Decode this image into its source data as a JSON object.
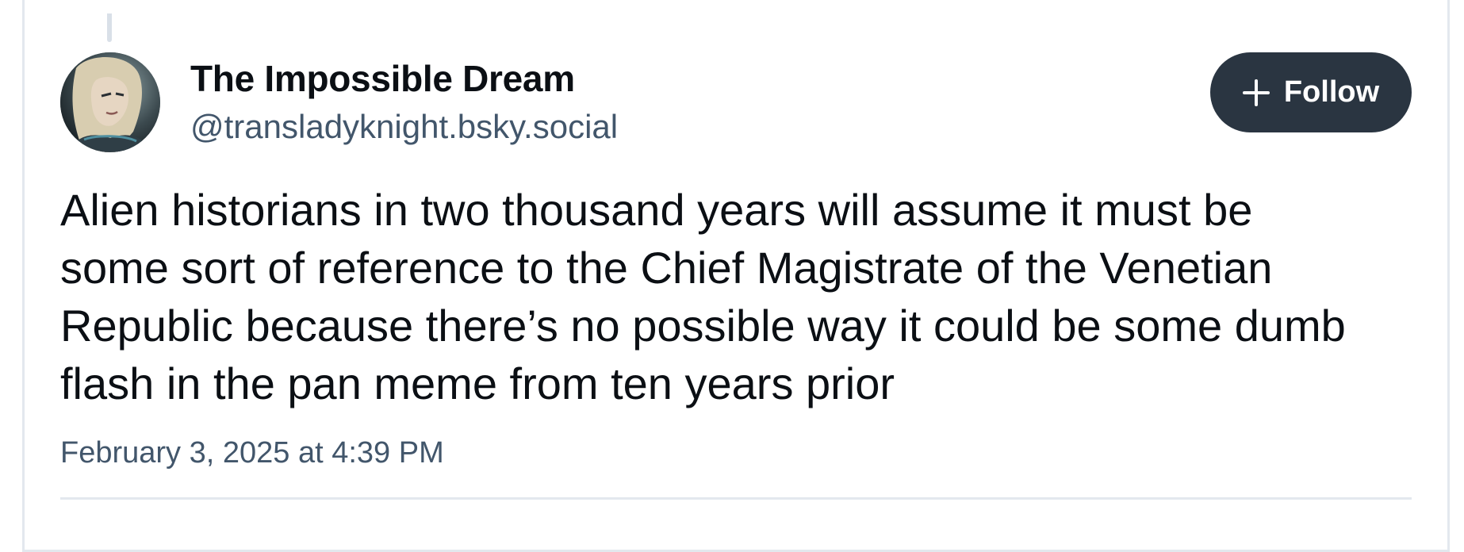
{
  "post": {
    "author": {
      "display_name": "The Impossible Dream",
      "handle": "@transladyknight.bsky.social",
      "avatar_icon": "avatar-portrait"
    },
    "follow_button": {
      "label": "Follow",
      "icon": "plus-icon",
      "background": "#2a3541"
    },
    "text_lines": [
      "Alien historians in two thousand years will assume it must be",
      "some sort of reference to the Chief Magistrate of the Venetian",
      "Republic because there’s no possible way it could be some dumb",
      "flash in the pan meme from ten years prior"
    ],
    "timestamp": "February 3, 2025 at 4:39 PM"
  },
  "colors": {
    "text_primary": "#0b0f14",
    "text_secondary": "#42566b",
    "border": "#e3e8ee"
  }
}
